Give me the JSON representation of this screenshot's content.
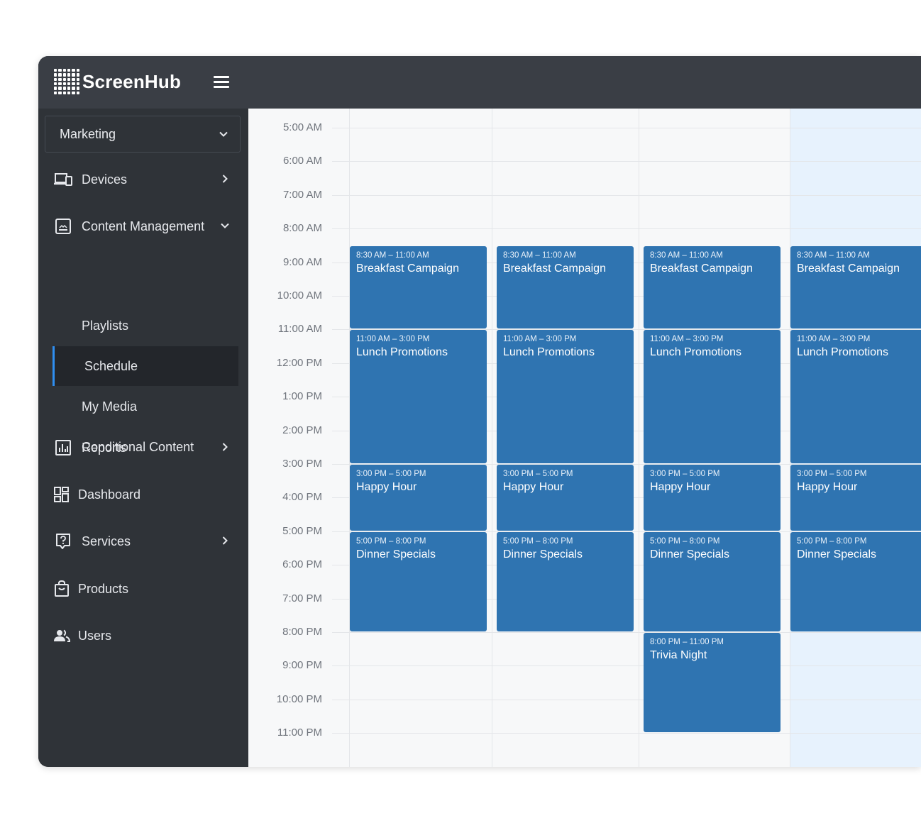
{
  "app": {
    "name": "ScreenHub",
    "menu_icon": "hamburger-icon",
    "logo_icon": "dot-grid-logo"
  },
  "sidebar": {
    "org_select": {
      "value": "Marketing",
      "icon": "chevron-down-icon"
    },
    "nav": [
      {
        "label": "Devices",
        "icon": "devices-icon",
        "arrow": "chevron-right-icon"
      },
      {
        "label": "Content Management",
        "icon": "image-frame-icon",
        "arrow": "chevron-down-icon",
        "expanded": true
      },
      {
        "label": "Reports",
        "icon": "bar-chart-icon",
        "arrow": "chevron-right-icon"
      },
      {
        "label": "Dashboard",
        "icon": "dashboard-grid-icon"
      },
      {
        "label": "Services",
        "icon": "help-box-icon",
        "arrow": "chevron-right-icon"
      },
      {
        "label": "Products",
        "icon": "shopping-bag-icon"
      },
      {
        "label": "Users",
        "icon": "users-icon"
      }
    ],
    "content_management_items": [
      {
        "label": "Playlists"
      },
      {
        "label": "Schedule",
        "active": true
      },
      {
        "label": "My Media"
      },
      {
        "label": "Conditional Content"
      }
    ]
  },
  "schedule": {
    "time_labels": [
      "5:00 AM",
      "6:00 AM",
      "7:00 AM",
      "8:00 AM",
      "9:00 AM",
      "10:00 AM",
      "11:00 AM",
      "12:00 PM",
      "1:00 PM",
      "2:00 PM",
      "3:00 PM",
      "4:00 PM",
      "5:00 PM",
      "6:00 PM",
      "7:00 PM",
      "8:00 PM",
      "9:00 PM",
      "10:00 PM",
      "11:00 PM"
    ],
    "days": [
      {
        "today": false,
        "events": [
          {
            "time": "8:30 AM – 11:00 AM",
            "title": "Breakfast Campaign"
          },
          {
            "time": "11:00 AM – 3:00 PM",
            "title": "Lunch Promotions"
          },
          {
            "time": "3:00 PM – 5:00 PM",
            "title": "Happy Hour"
          },
          {
            "time": "5:00 PM – 8:00 PM",
            "title": "Dinner Specials"
          }
        ]
      },
      {
        "today": false,
        "events": [
          {
            "time": "8:30 AM – 11:00 AM",
            "title": "Breakfast Campaign"
          },
          {
            "time": "11:00 AM – 3:00 PM",
            "title": "Lunch Promotions"
          },
          {
            "time": "3:00 PM – 5:00 PM",
            "title": "Happy Hour"
          },
          {
            "time": "5:00 PM – 8:00 PM",
            "title": "Dinner Specials"
          }
        ]
      },
      {
        "today": false,
        "events": [
          {
            "time": "8:30 AM – 11:00 AM",
            "title": "Breakfast Campaign"
          },
          {
            "time": "11:00 AM – 3:00 PM",
            "title": "Lunch Promotions"
          },
          {
            "time": "3:00 PM – 5:00 PM",
            "title": "Happy Hour"
          },
          {
            "time": "5:00 PM – 8:00 PM",
            "title": "Dinner Specials"
          },
          {
            "time": "8:00 PM – 11:00 PM",
            "title": "Trivia Night"
          }
        ]
      },
      {
        "today": true,
        "events": [
          {
            "time": "8:30 AM – 11:00 AM",
            "title": "Breakfast Campaign"
          },
          {
            "time": "11:00 AM – 3:00 PM",
            "title": "Lunch Promotions"
          },
          {
            "time": "3:00 PM – 5:00 PM",
            "title": "Happy Hour"
          },
          {
            "time": "5:00 PM – 8:00 PM",
            "title": "Dinner Specials"
          }
        ]
      }
    ],
    "colors": {
      "event": "#2f74b1",
      "today_column": "#e7f2fd",
      "current_time_line": "#6fae6a",
      "active_accent": "#2f8ef0"
    }
  }
}
